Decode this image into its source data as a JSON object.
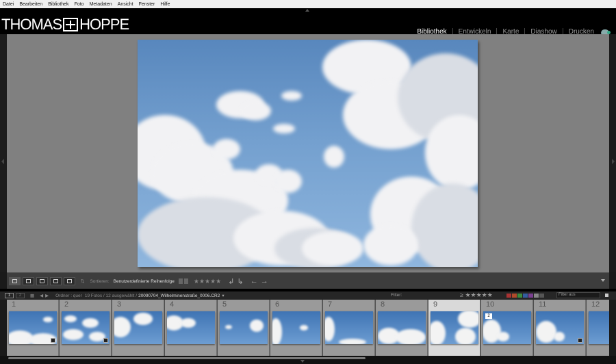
{
  "menu": [
    "Datei",
    "Bearbeiten",
    "Bibliothek",
    "Foto",
    "Metadaten",
    "Ansicht",
    "Fenster",
    "Hilfe"
  ],
  "brand": {
    "left": "THOMAS",
    "right": "HOPPE"
  },
  "modules": [
    {
      "label": "Bibliothek",
      "active": true
    },
    {
      "label": "Entwickeln",
      "active": false
    },
    {
      "label": "Karte",
      "active": false
    },
    {
      "label": "Diashow",
      "active": false
    },
    {
      "label": "Drucken",
      "active": false
    }
  ],
  "toolbar": {
    "sort_label": "Sortieren:",
    "sort_value": "Benutzerdefinierte Reihenfolge",
    "stars": "★★★★★",
    "rotate_left": "↲",
    "rotate_right": "↳",
    "prev": "←",
    "next": "→"
  },
  "filmbar": {
    "page1": "1",
    "page2": "2",
    "source_prefix": "Ordner : quer",
    "source_count": "19 Fotos / 12 ausgewählt /",
    "source_file": "20090704_Wilhelminenstraße_0006.CR2",
    "filter_label": "Filter:",
    "filter_stars": "≥ ★★★★★",
    "filter_select": "Filter aus",
    "swatch_colors": [
      "#a83232",
      "#b04a2a",
      "#3c8a3c",
      "#335d9e",
      "#7a3f90",
      "#888888",
      "#555555"
    ]
  },
  "filmstrip": [
    {
      "num": "1",
      "selected": false,
      "badge": true,
      "stack": ""
    },
    {
      "num": "2",
      "selected": false,
      "badge": true,
      "stack": ""
    },
    {
      "num": "3",
      "selected": false,
      "badge": false,
      "stack": ""
    },
    {
      "num": "4",
      "selected": false,
      "badge": false,
      "stack": ""
    },
    {
      "num": "5",
      "selected": false,
      "badge": false,
      "stack": ""
    },
    {
      "num": "6",
      "selected": false,
      "badge": false,
      "stack": ""
    },
    {
      "num": "7",
      "selected": false,
      "badge": false,
      "stack": ""
    },
    {
      "num": "8",
      "selected": false,
      "badge": false,
      "stack": ""
    },
    {
      "num": "9",
      "selected": true,
      "badge": false,
      "stack": ""
    },
    {
      "num": "10",
      "selected": false,
      "badge": false,
      "stack": "2"
    },
    {
      "num": "11",
      "selected": false,
      "badge": true,
      "stack": ""
    },
    {
      "num": "12",
      "selected": false,
      "badge": false,
      "stack": ""
    }
  ]
}
